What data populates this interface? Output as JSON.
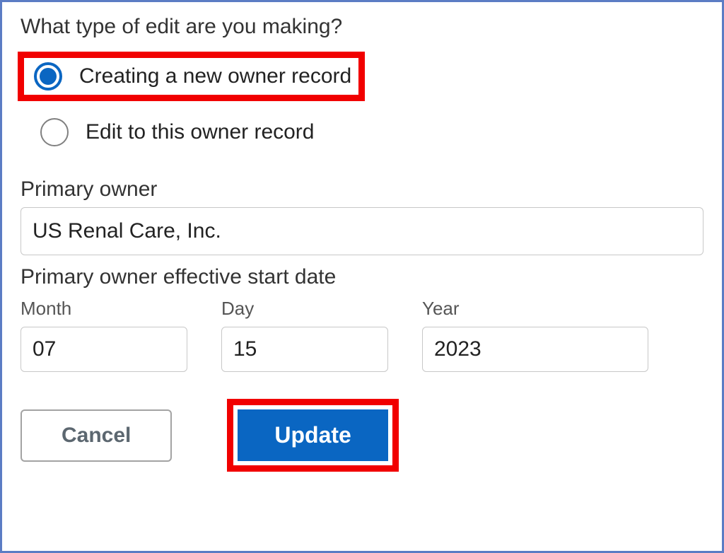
{
  "question": "What type of edit are you making?",
  "radio": {
    "option1": "Creating a new owner record",
    "option2": "Edit to this owner record"
  },
  "primaryOwner": {
    "label": "Primary owner",
    "value": "US Renal Care, Inc."
  },
  "effectiveDate": {
    "label": "Primary owner effective start date",
    "month": {
      "label": "Month",
      "value": "07"
    },
    "day": {
      "label": "Day",
      "value": "15"
    },
    "year": {
      "label": "Year",
      "value": "2023"
    }
  },
  "buttons": {
    "cancel": "Cancel",
    "update": "Update"
  }
}
